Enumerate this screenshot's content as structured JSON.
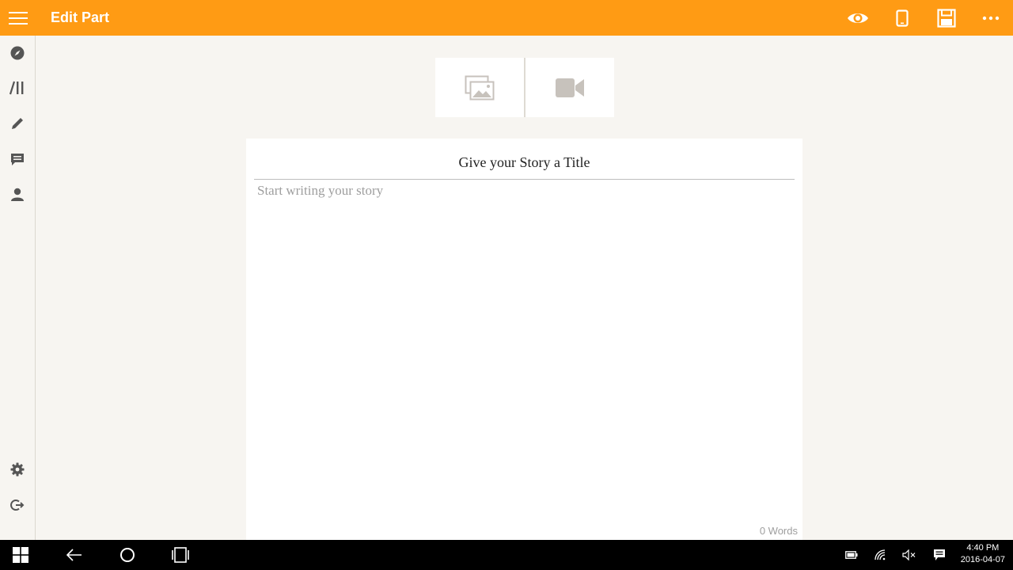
{
  "header": {
    "title": "Edit Part",
    "background": "#ff9b14",
    "actions": [
      "eye-icon",
      "phone-icon",
      "save-icon",
      "more-icon"
    ]
  },
  "sidebar": {
    "items": [
      "compass-icon",
      "library-icon",
      "pencil-icon",
      "messages-icon",
      "profile-icon"
    ],
    "bottom_items": [
      "settings-icon",
      "logout-icon"
    ]
  },
  "media": {
    "buttons": [
      "image-icon",
      "video-icon"
    ]
  },
  "editor": {
    "title_value": "Give your Story a Title",
    "body_placeholder": "Start writing your story",
    "word_count": "0 Words"
  },
  "taskbar": {
    "time": "4:40 PM",
    "date": "2016-04-07"
  }
}
